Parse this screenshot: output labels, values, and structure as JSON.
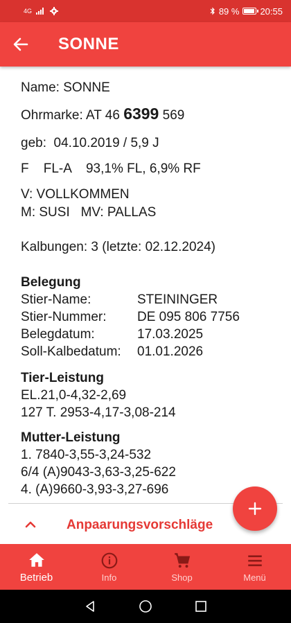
{
  "status": {
    "network": "4G",
    "battery": "89 %",
    "time": "20:55"
  },
  "app_bar": {
    "title": "SONNE"
  },
  "animal": {
    "name": "Name: SONNE",
    "ear_tag_prefix": "Ohrmarke: AT 46 ",
    "ear_tag_bold": "6399",
    "ear_tag_suffix": " 569",
    "birth": "geb:  04.10.2019 / 5,9 J",
    "breed_line": "F    FL-A    93,1% FL, 6,9% RF",
    "father": "V: VOLLKOMMEN",
    "mother": "M: SUSI   MV: PALLAS",
    "calvings": "Kalbungen: 3 (letzte: 02.12.2024)"
  },
  "belegung": {
    "title": "Belegung",
    "rows": [
      {
        "key": "Stier-Name:",
        "value": "STEININGER"
      },
      {
        "key": "Stier-Nummer:",
        "value": "DE 095 806 7756"
      },
      {
        "key": "Belegdatum:",
        "value": "17.03.2025"
      },
      {
        "key": "Soll-Kalbedatum:",
        "value": "01.01.2026"
      }
    ]
  },
  "tier_leistung": {
    "title": "Tier-Leistung",
    "lines": [
      "EL.21,0-4,32-2,69",
      "127 T. 2953-4,17-3,08-214"
    ]
  },
  "mutter_leistung": {
    "title": "Mutter-Leistung",
    "lines": [
      "1. 7840-3,55-3,24-532",
      "6/4 (A)9043-3,63-3,25-622",
      "4. (A)9660-3,93-3,27-696"
    ]
  },
  "pairing": {
    "label": "Anpaarungsvorschläge"
  },
  "nav": {
    "items": [
      {
        "label": "Betrieb",
        "icon": "home-icon"
      },
      {
        "label": "Info",
        "icon": "info-icon"
      },
      {
        "label": "Shop",
        "icon": "cart-icon"
      },
      {
        "label": "Menü",
        "icon": "menu-icon"
      }
    ]
  },
  "colors": {
    "primary": "#f0433f",
    "status_bar": "#d9332f",
    "accent_text": "#e53935"
  }
}
